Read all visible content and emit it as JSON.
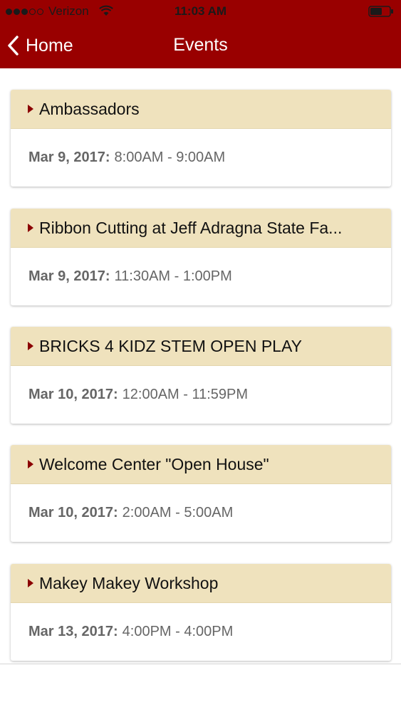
{
  "status_bar": {
    "carrier": "Verizon",
    "time": "11:03 AM"
  },
  "nav": {
    "back_label": "Home",
    "title": "Events"
  },
  "events": [
    {
      "title": "Ambassadors",
      "date": "Mar 9, 2017:",
      "time": "8:00AM - 9:00AM"
    },
    {
      "title": "Ribbon Cutting at Jeff Adragna State Fa...",
      "date": "Mar 9, 2017:",
      "time": "11:30AM - 1:00PM"
    },
    {
      "title": "BRICKS 4 KIDZ STEM OPEN PLAY",
      "date": "Mar 10, 2017:",
      "time": "12:00AM - 11:59PM"
    },
    {
      "title": "Welcome Center \"Open House\"",
      "date": "Mar 10, 2017:",
      "time": "2:00AM - 5:00AM"
    },
    {
      "title": "Makey Makey Workshop",
      "date": "Mar 13, 2017:",
      "time": "4:00PM - 4:00PM"
    }
  ],
  "colors": {
    "nav_bar": "#990000",
    "card_header": "#efe2bd",
    "caret": "#8b0000"
  }
}
